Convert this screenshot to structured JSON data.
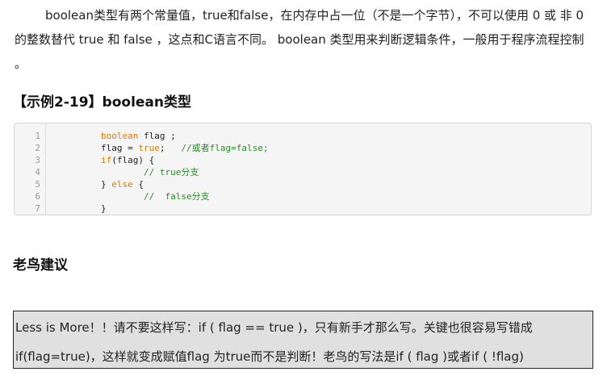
{
  "intro": {
    "paragraph": "boolean类型有两个常量值，true和false，在内存中占一位（不是一个字节），不可以使用 0 或 非 0 的整数替代 true 和 false ，这点和C语言不同。 boolean 类型用来判断逻辑条件，一般用于程序流程控制 。"
  },
  "example": {
    "title": "【示例2-19】boolean类型"
  },
  "code": {
    "line_numbers": [
      "1",
      "2",
      "3",
      "4",
      "5",
      "6",
      "7"
    ],
    "l1_kw": "boolean",
    "l1_rest": " flag ;",
    "l2_pre": "flag = ",
    "l2_kw": "true",
    "l2_post": ";   ",
    "l2_comment": "//或者flag=false;",
    "l3_kw": "if",
    "l3_rest": "(flag) {",
    "l4_comment": "// true分支",
    "l5_pre": "} ",
    "l5_kw": "else",
    "l5_post": " {",
    "l6_comment": "//  false分支",
    "l7_text": "}"
  },
  "advice": {
    "title": "老鸟建议",
    "line1": "Less is More！！请不要这样写：if ( flag == true )，只有新手才那么写。关键也很容易写错成",
    "line2": "if(flag=true)，这样就变成赋值flag 为true而不是判断！老鸟的写法是if ( flag )或者if ( !flag)"
  },
  "colors": {
    "keyword": "#e07b00",
    "comment": "#2a8a2a",
    "note_background": "#e0e0e0"
  }
}
